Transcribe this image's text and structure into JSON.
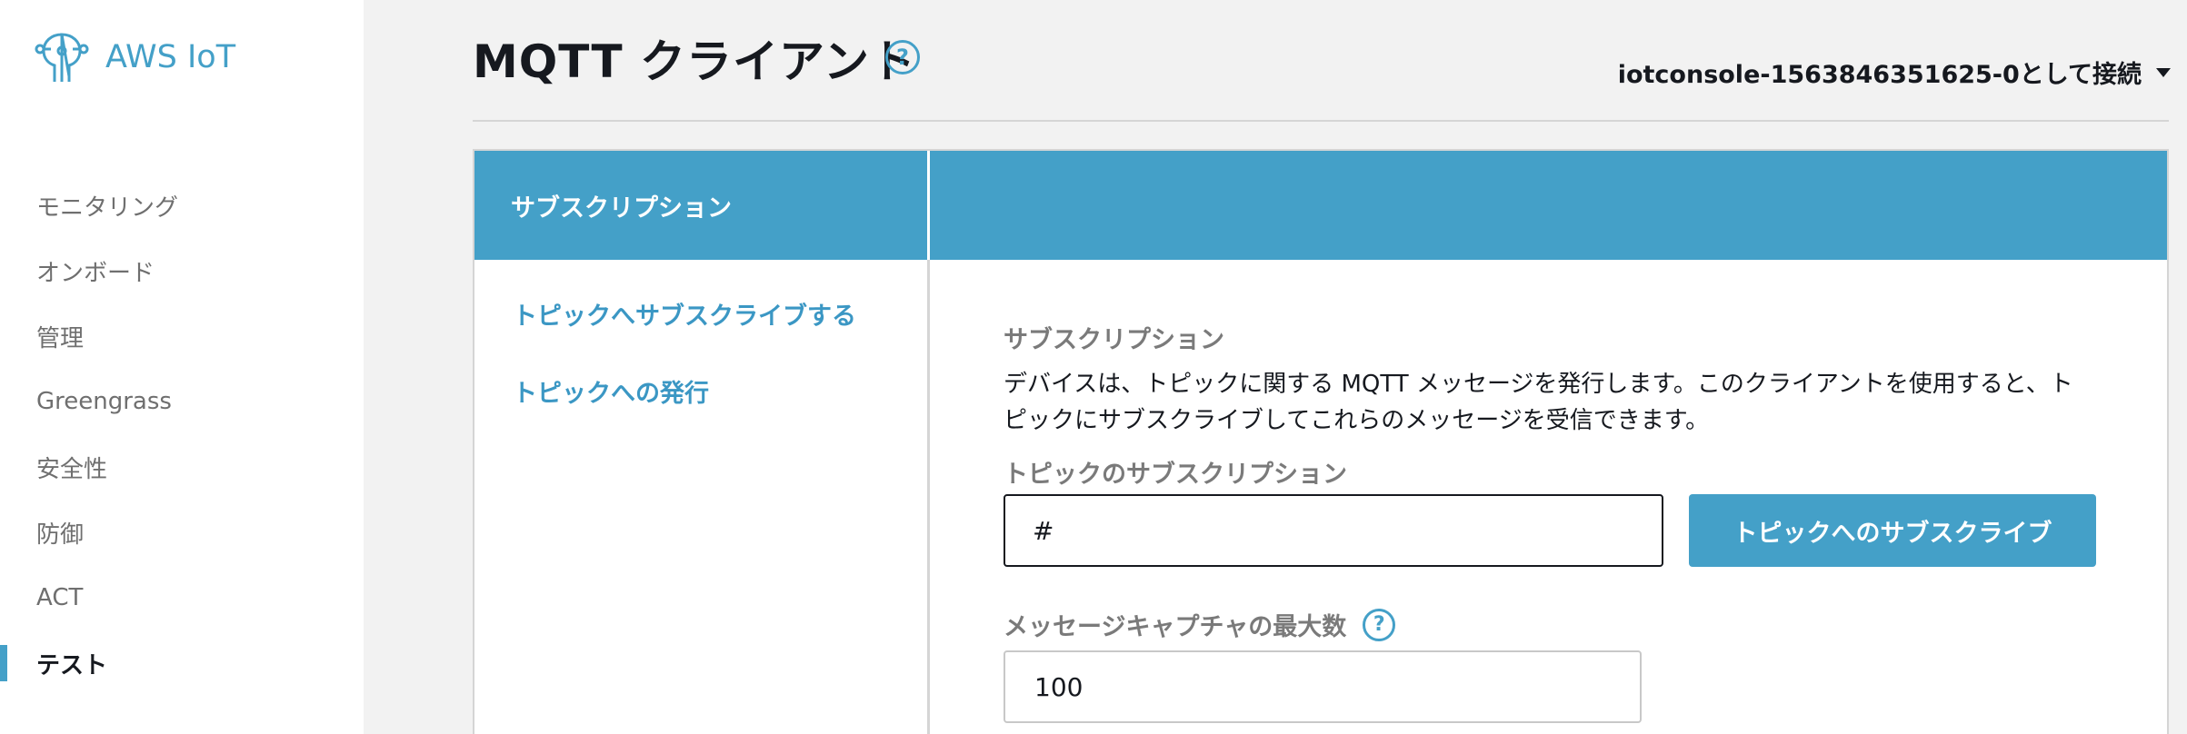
{
  "brand": {
    "name": "AWS IoT",
    "color": "#44a0c8"
  },
  "sidebar": {
    "items": [
      {
        "label": "モニタリング"
      },
      {
        "label": "オンボード"
      },
      {
        "label": "管理"
      },
      {
        "label": "Greengrass"
      },
      {
        "label": "安全性"
      },
      {
        "label": "防御"
      },
      {
        "label": "ACT"
      },
      {
        "label": "テスト",
        "active": true
      }
    ]
  },
  "header": {
    "title": "MQTT クライアント",
    "help_icon": "question-circle-icon",
    "connection": "iotconsole-1563846351625-0として接続"
  },
  "panel": {
    "header_label": "サブスクリプション",
    "nav": [
      {
        "label": "トピックへサブスクライブする"
      },
      {
        "label": "トピックへの発行"
      }
    ],
    "section": {
      "title": "サブスクリプション",
      "description": "デバイスは、トピックに関する MQTT メッセージを発行します。このクライアントを使用すると、トピックにサブスクライブしてこれらのメッセージを受信できます。"
    },
    "topic_field": {
      "label": "トピックのサブスクリプション",
      "value": "#"
    },
    "subscribe_button": "トピックへのサブスクライブ",
    "max_field": {
      "label": "メッセージキャプチャの最大数",
      "value": "100"
    }
  },
  "colors": {
    "accent": "#44a0c8",
    "header_bg": "#44a0c8",
    "text": "#16191f",
    "muted": "#7a7a7a"
  }
}
